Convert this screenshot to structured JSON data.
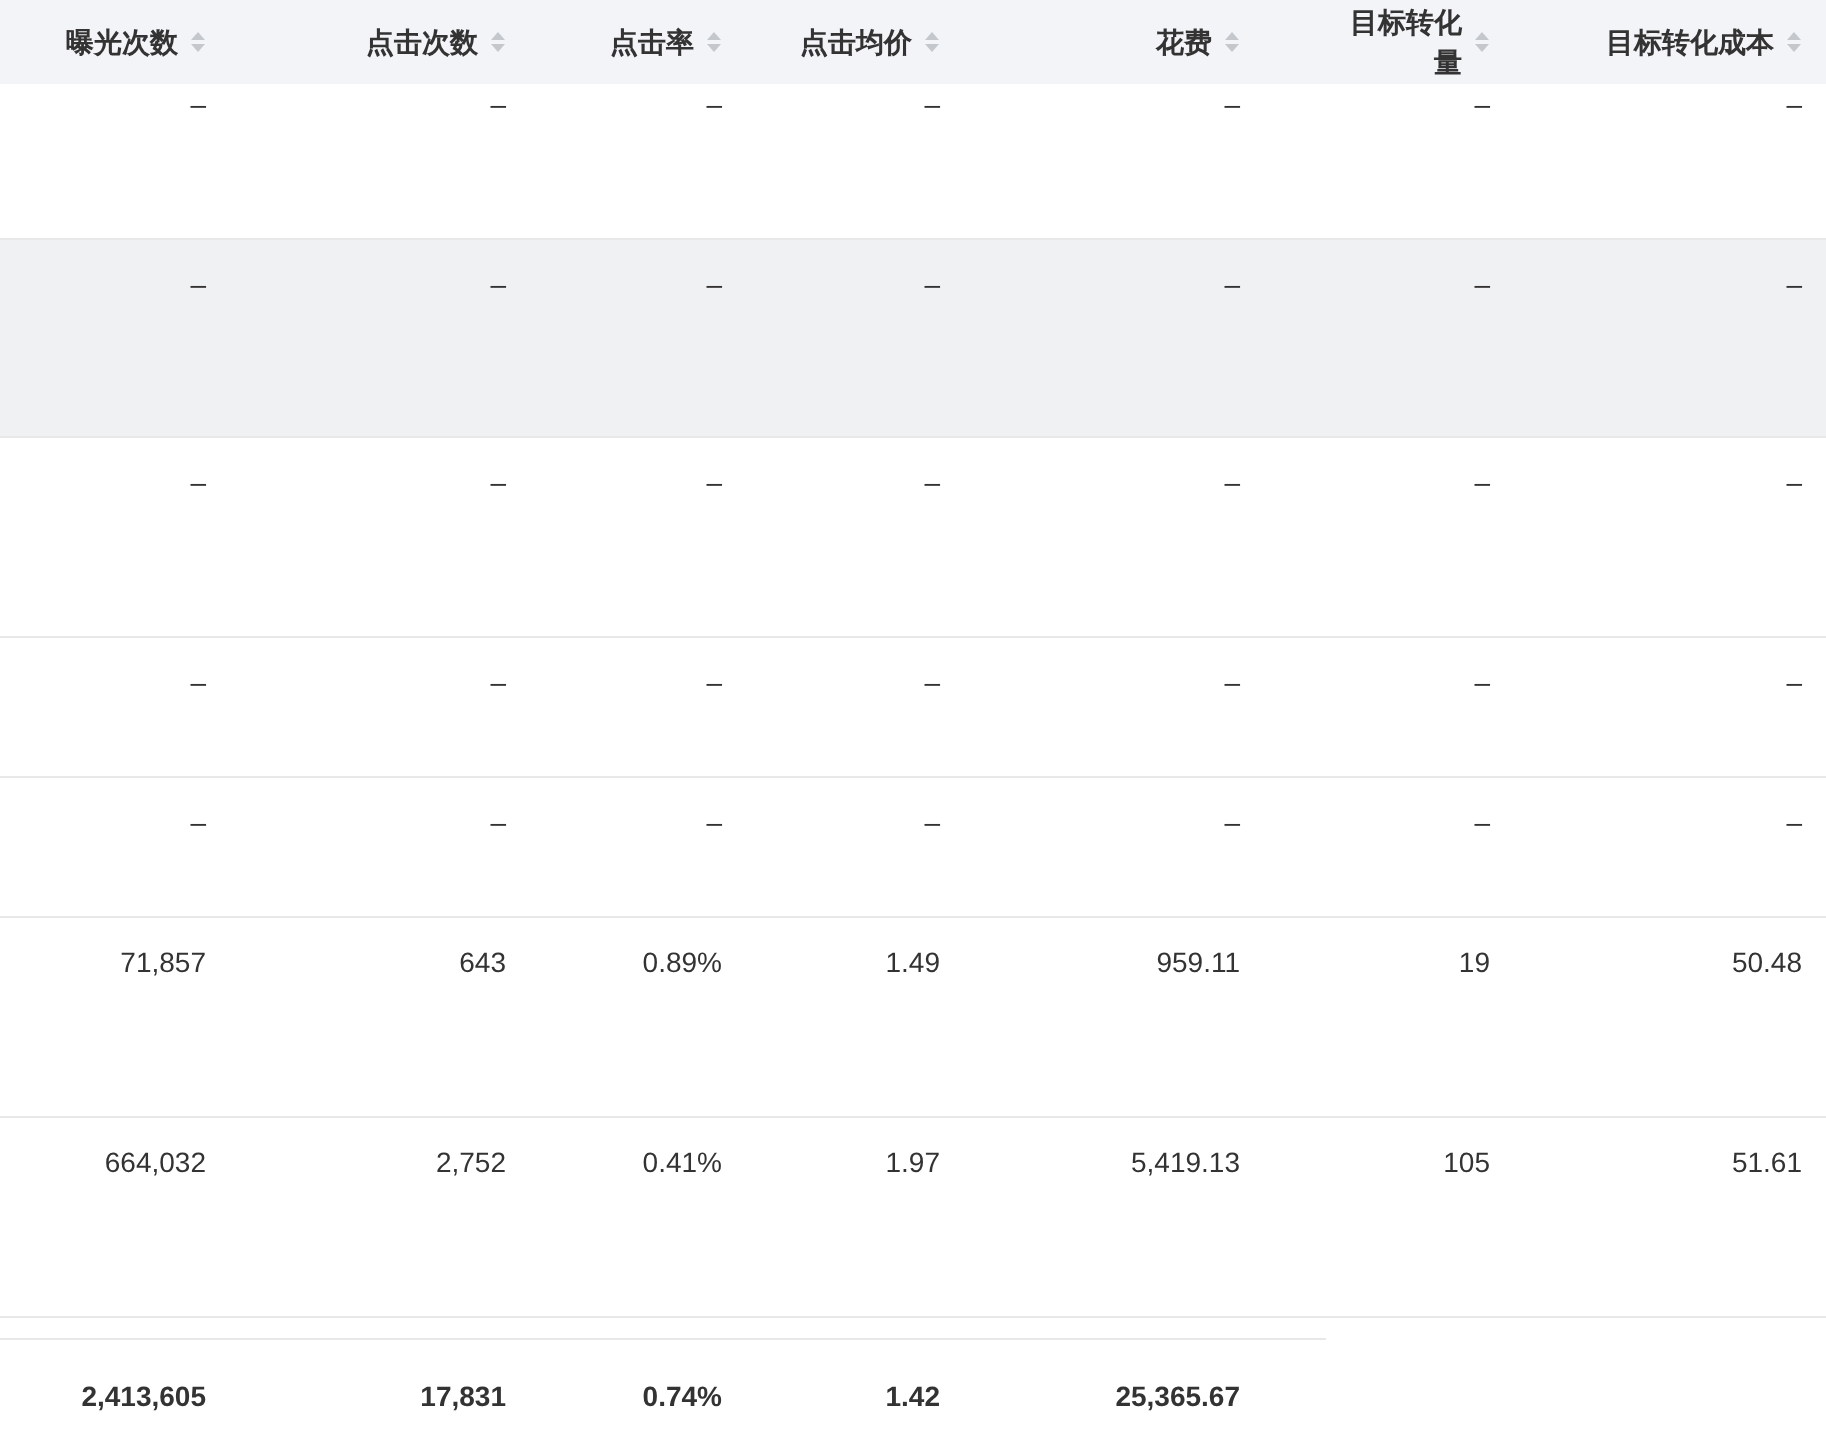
{
  "table": {
    "columns": [
      {
        "label": "曝光次数",
        "sortable": true
      },
      {
        "label": "点击次数",
        "sortable": true
      },
      {
        "label": "点击率",
        "sortable": true
      },
      {
        "label": "点击均价",
        "sortable": true
      },
      {
        "label": "花费",
        "sortable": true
      },
      {
        "label": "目标转化量",
        "sortable": true
      },
      {
        "label": "目标转化成本",
        "sortable": true
      }
    ],
    "rows": [
      {
        "highlighted": false,
        "cells": [
          "–",
          "–",
          "–",
          "–",
          "–",
          "–",
          "–"
        ]
      },
      {
        "highlighted": true,
        "cells": [
          "–",
          "–",
          "–",
          "–",
          "–",
          "–",
          "–"
        ]
      },
      {
        "highlighted": false,
        "cells": [
          "–",
          "–",
          "–",
          "–",
          "–",
          "–",
          "–"
        ]
      },
      {
        "highlighted": false,
        "cells": [
          "–",
          "–",
          "–",
          "–",
          "–",
          "–",
          "–"
        ]
      },
      {
        "highlighted": false,
        "cells": [
          "–",
          "–",
          "–",
          "–",
          "–",
          "–",
          "–"
        ]
      },
      {
        "highlighted": false,
        "cells": [
          "71,857",
          "643",
          "0.89%",
          "1.49",
          "959.11",
          "19",
          "50.48"
        ]
      },
      {
        "highlighted": false,
        "cells": [
          "664,032",
          "2,752",
          "0.41%",
          "1.97",
          "5,419.13",
          "105",
          "51.61"
        ]
      }
    ],
    "summary": [
      "2,413,605",
      "17,831",
      "0.74%",
      "1.42",
      "25,365.67"
    ]
  }
}
